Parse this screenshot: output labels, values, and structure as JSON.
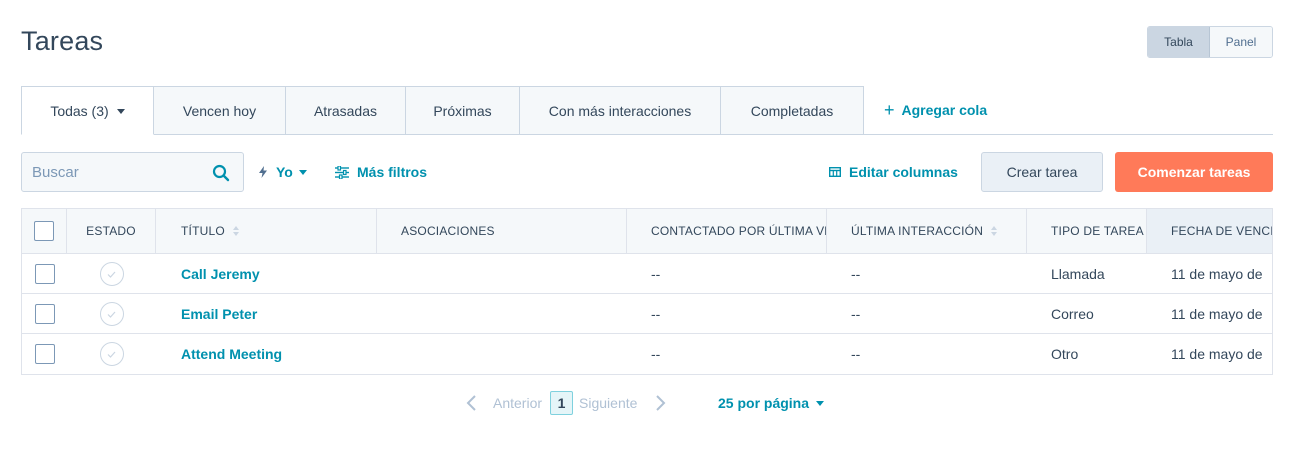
{
  "page": {
    "title": "Tareas"
  },
  "view_toggle": {
    "table_label": "Tabla",
    "board_label": "Panel",
    "selected": "Tabla"
  },
  "tabs": [
    {
      "label": "Todas (3)",
      "active": true,
      "has_caret": true
    },
    {
      "label": "Vencen hoy"
    },
    {
      "label": "Atrasadas"
    },
    {
      "label": "Próximas"
    },
    {
      "label": "Con más interacciones"
    },
    {
      "label": "Completadas"
    }
  ],
  "add_queue": {
    "label": "Agregar cola",
    "icon": "plus-icon"
  },
  "toolbar": {
    "search_placeholder": "Buscar",
    "search_icon": "search-icon",
    "owner_filter_label": "Yo",
    "more_filters_label": "Más filtros",
    "edit_columns_label": "Editar columnas",
    "create_task_label": "Crear tarea",
    "start_tasks_label": "Comenzar tareas"
  },
  "colors": {
    "accent": "#0091ae",
    "primary_button": "#ff7a59",
    "text": "#33475b",
    "header_bg": "#f5f8fa",
    "border": "#dfe3eb"
  },
  "table": {
    "columns": [
      {
        "label": ""
      },
      {
        "label": "ESTADO"
      },
      {
        "label": "TÍTULO",
        "sortable": true
      },
      {
        "label": "ASOCIACIONES"
      },
      {
        "label": "CONTACTADO POR ÚLTIMA VEZ"
      },
      {
        "label": "ÚLTIMA INTERACCIÓN",
        "sortable": true
      },
      {
        "label": "TIPO DE TAREA",
        "sortable": true
      },
      {
        "label": "FECHA DE VENCIMIENTO"
      }
    ],
    "rows": [
      {
        "title": "Call Jeremy",
        "associations": "",
        "last_contacted": "--",
        "last_engagement": "--",
        "task_type": "Llamada",
        "due_date": "11 de mayo de"
      },
      {
        "title": "Email Peter",
        "associations": "",
        "last_contacted": "--",
        "last_engagement": "--",
        "task_type": "Correo",
        "due_date": "11 de mayo de"
      },
      {
        "title": "Attend Meeting",
        "associations": "",
        "last_contacted": "--",
        "last_engagement": "--",
        "task_type": "Otro",
        "due_date": "11 de mayo de"
      }
    ]
  },
  "pagination": {
    "prev_label": "Anterior",
    "current_page": "1",
    "next_label": "Siguiente",
    "per_page_label": "25 por página"
  }
}
